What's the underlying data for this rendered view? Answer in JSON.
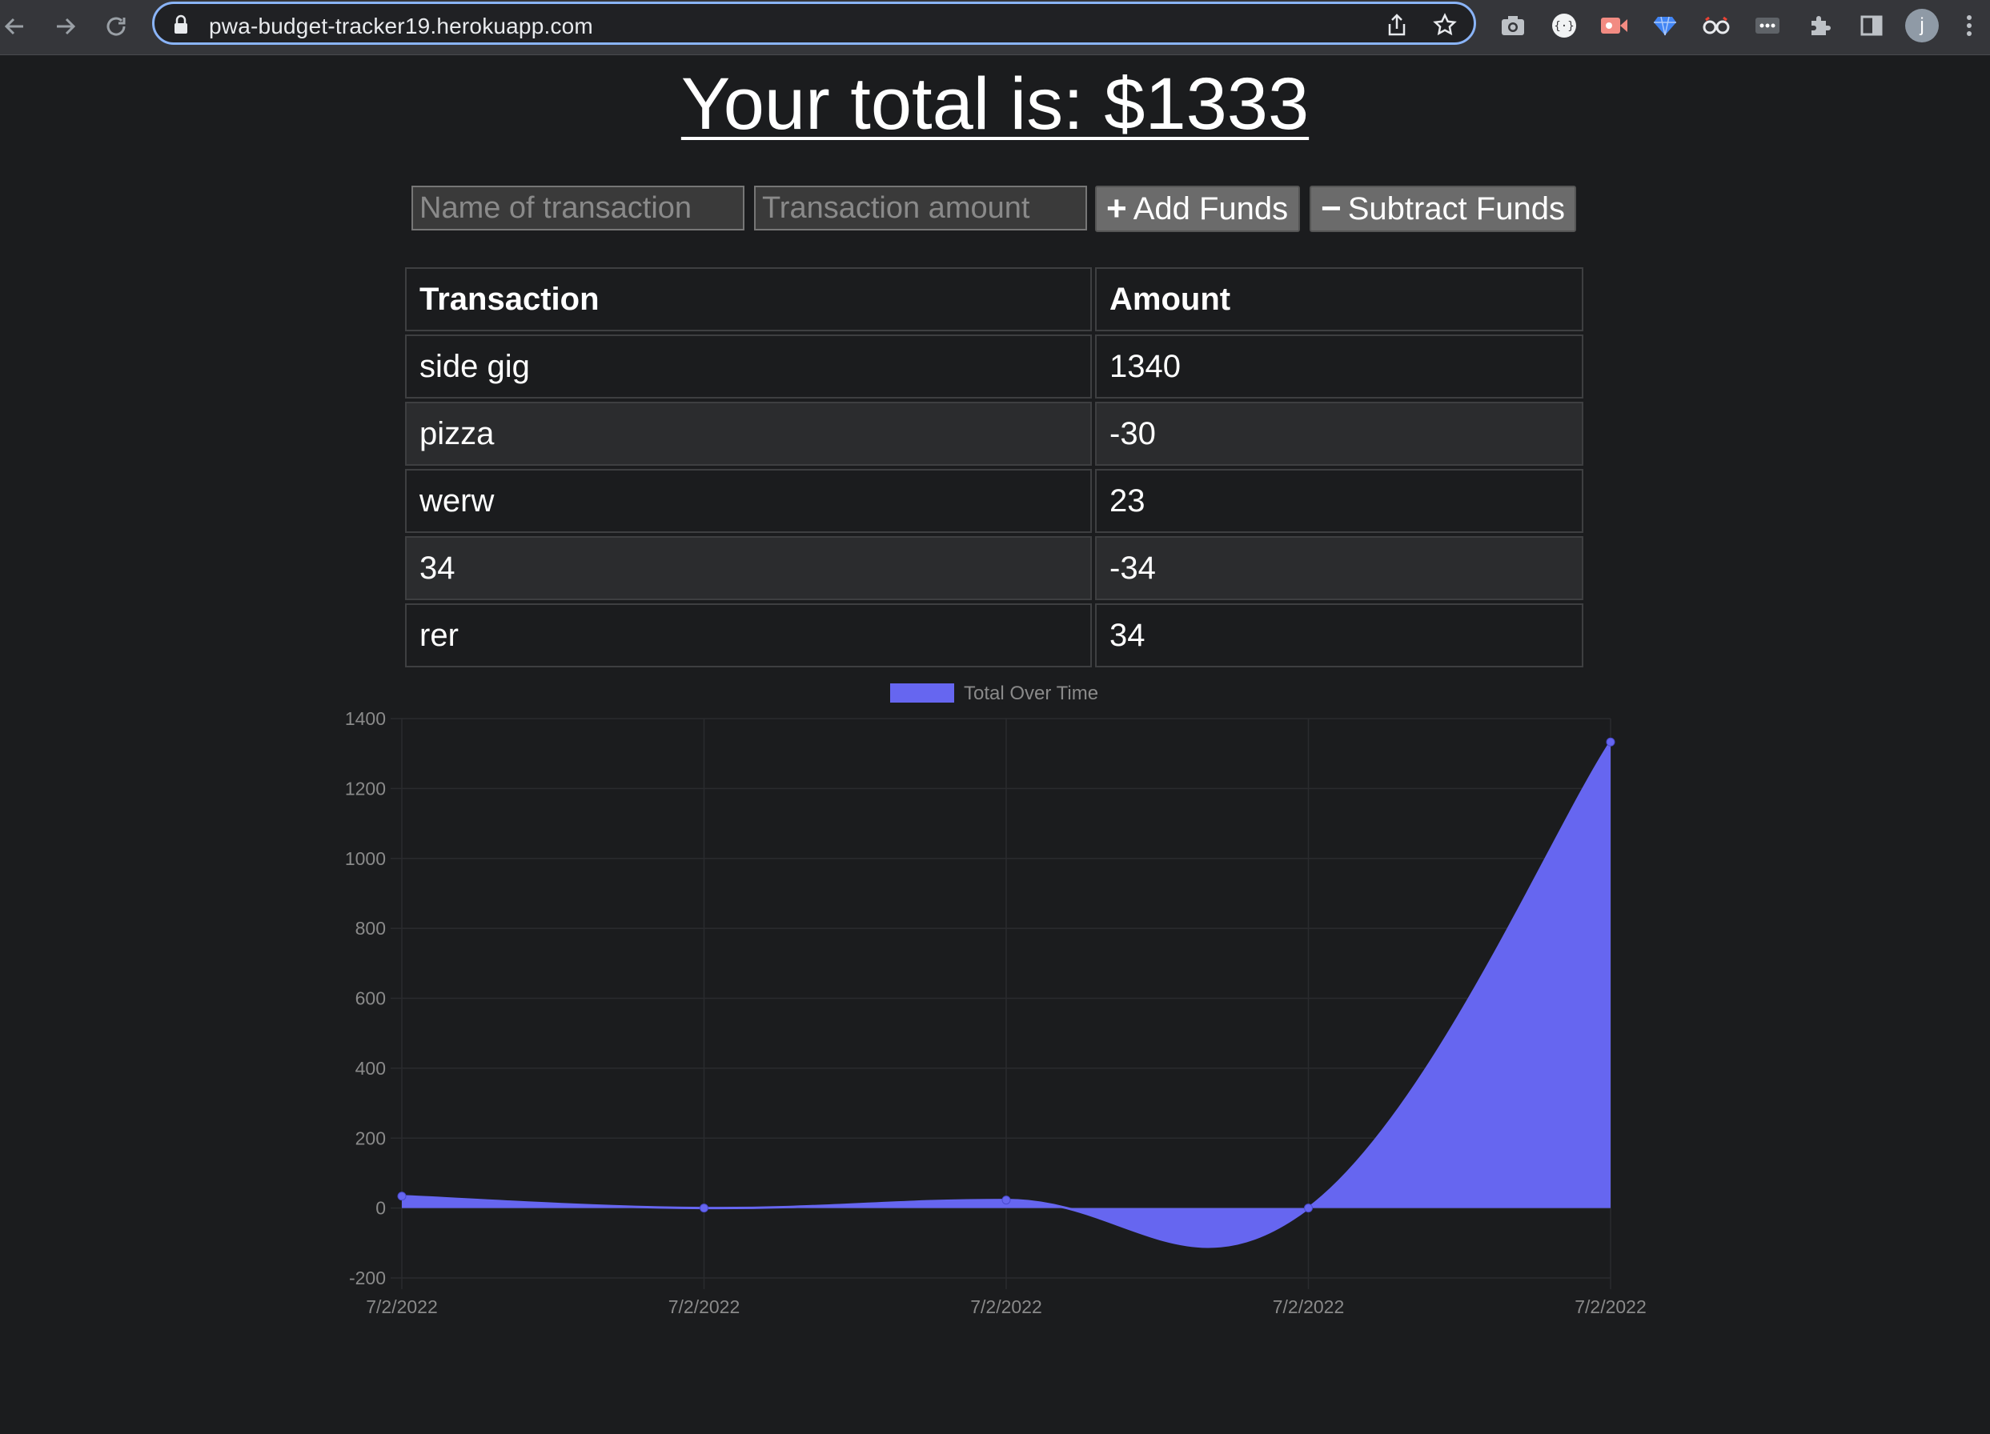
{
  "browser": {
    "url": "pwa-budget-tracker19.herokuapp.com",
    "profile_initial": "j",
    "extensions": [
      "camera-icon",
      "code-ext-icon",
      "video-ext-icon",
      "diamond-ext-icon",
      "glasses-ext-icon",
      "dots-ext-icon",
      "puzzle-icon",
      "sidepanel-icon"
    ]
  },
  "page": {
    "total_text": "Your total is: $1333",
    "form": {
      "name_placeholder": "Name of transaction",
      "amount_placeholder": "Transaction amount",
      "add_label": "Add Funds",
      "add_icon": "+",
      "subtract_label": "Subtract Funds",
      "subtract_icon": "−"
    },
    "table": {
      "headers": [
        "Transaction",
        "Amount"
      ],
      "rows": [
        [
          "side gig",
          "1340"
        ],
        [
          "pizza",
          "-30"
        ],
        [
          "werw",
          "23"
        ],
        [
          "34",
          "-34"
        ],
        [
          "rer",
          "34"
        ]
      ]
    }
  },
  "chart_data": {
    "type": "area",
    "legend": "Total Over Time",
    "legend_position": "top",
    "color": "#6666f0",
    "x": [
      "7/2/2022",
      "7/2/2022",
      "7/2/2022",
      "7/2/2022",
      "7/2/2022"
    ],
    "series": [
      {
        "name": "Total Over Time",
        "values": [
          34,
          0,
          23,
          0,
          1333
        ]
      }
    ],
    "ylim": [
      -200,
      1400
    ],
    "yticks": [
      1400,
      1200,
      1000,
      800,
      600,
      400,
      200,
      0,
      -200
    ],
    "grid": true,
    "smooth": true
  }
}
